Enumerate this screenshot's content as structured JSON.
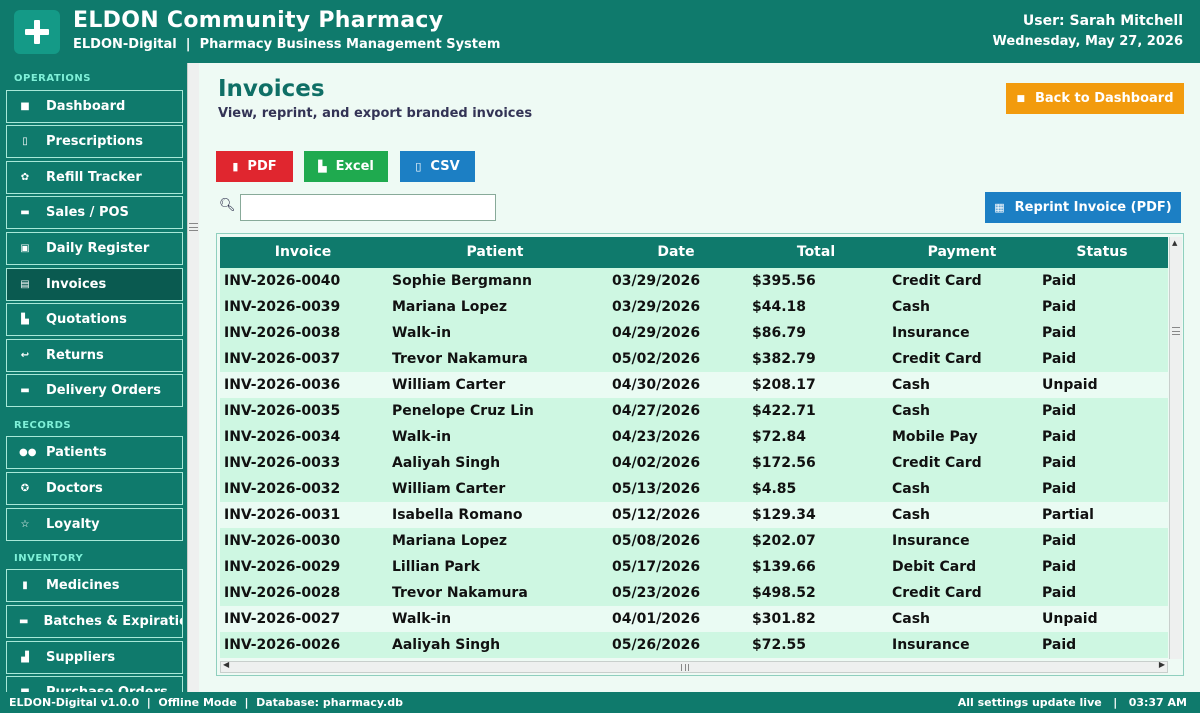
{
  "header": {
    "title": "ELDON Community Pharmacy",
    "subtitle": "ELDON-Digital  |  Pharmacy Business Management System",
    "user": "User: Sarah Mitchell",
    "date": "Wednesday, May 27, 2026"
  },
  "sidebar": {
    "sections": {
      "operations": "OPERATIONS",
      "records": "RECORDS",
      "inventory": "INVENTORY"
    },
    "items": [
      {
        "label": "Dashboard",
        "icon": "home-icon",
        "glyph": "■"
      },
      {
        "label": "Prescriptions",
        "icon": "clipboard-icon",
        "glyph": "▯"
      },
      {
        "label": "Refill Tracker",
        "icon": "refill-icon",
        "glyph": "✿"
      },
      {
        "label": "Sales / POS",
        "icon": "register-icon",
        "glyph": "▬"
      },
      {
        "label": "Daily Register",
        "icon": "calendar-icon",
        "glyph": "▣"
      },
      {
        "label": "Invoices",
        "icon": "invoice-icon",
        "glyph": "▤"
      },
      {
        "label": "Quotations",
        "icon": "document-icon",
        "glyph": "▙"
      },
      {
        "label": "Returns",
        "icon": "return-arrow-icon",
        "glyph": "↩"
      },
      {
        "label": "Delivery Orders",
        "icon": "truck-icon",
        "glyph": "▬"
      },
      {
        "label": "Patients",
        "icon": "users-icon",
        "glyph": "●●"
      },
      {
        "label": "Doctors",
        "icon": "stethoscope-icon",
        "glyph": "✪"
      },
      {
        "label": "Loyalty",
        "icon": "star-icon",
        "glyph": "☆"
      },
      {
        "label": "Medicines",
        "icon": "medicine-icon",
        "glyph": "▮"
      },
      {
        "label": "Batches & Expirations",
        "icon": "batch-icon",
        "glyph": "▬"
      },
      {
        "label": "Suppliers",
        "icon": "supplier-icon",
        "glyph": "▟"
      },
      {
        "label": "Purchase Orders",
        "icon": "purchase-icon",
        "glyph": "■"
      }
    ]
  },
  "page": {
    "title": "Invoices",
    "subtitle": "View, reprint, and export branded invoices",
    "back_label": "Back to Dashboard"
  },
  "export": {
    "pdf": "PDF",
    "excel": "Excel",
    "csv": "CSV"
  },
  "search": {
    "value": "",
    "placeholder": ""
  },
  "reprint_label": "Reprint Invoice (PDF)",
  "table": {
    "columns": [
      "Invoice",
      "Patient",
      "Date",
      "Total",
      "Payment",
      "Status"
    ],
    "rows": [
      [
        "INV-2026-0040",
        "Sophie Bergmann",
        "03/29/2026",
        "$395.56",
        "Credit Card",
        "Paid"
      ],
      [
        "INV-2026-0039",
        "Mariana Lopez",
        "03/29/2026",
        "$44.18",
        "Cash",
        "Paid"
      ],
      [
        "INV-2026-0038",
        "Walk-in",
        "04/29/2026",
        "$86.79",
        "Insurance",
        "Paid"
      ],
      [
        "INV-2026-0037",
        "Trevor Nakamura",
        "05/02/2026",
        "$382.79",
        "Credit Card",
        "Paid"
      ],
      [
        "INV-2026-0036",
        "William Carter",
        "04/30/2026",
        "$208.17",
        "Cash",
        "Unpaid"
      ],
      [
        "INV-2026-0035",
        "Penelope Cruz Lin",
        "04/27/2026",
        "$422.71",
        "Cash",
        "Paid"
      ],
      [
        "INV-2026-0034",
        "Walk-in",
        "04/23/2026",
        "$72.84",
        "Mobile Pay",
        "Paid"
      ],
      [
        "INV-2026-0033",
        "Aaliyah Singh",
        "04/02/2026",
        "$172.56",
        "Credit Card",
        "Paid"
      ],
      [
        "INV-2026-0032",
        "William Carter",
        "05/13/2026",
        "$4.85",
        "Cash",
        "Paid"
      ],
      [
        "INV-2026-0031",
        "Isabella Romano",
        "05/12/2026",
        "$129.34",
        "Cash",
        "Partial"
      ],
      [
        "INV-2026-0030",
        "Mariana Lopez",
        "05/08/2026",
        "$202.07",
        "Insurance",
        "Paid"
      ],
      [
        "INV-2026-0029",
        "Lillian Park",
        "05/17/2026",
        "$139.66",
        "Debit Card",
        "Paid"
      ],
      [
        "INV-2026-0028",
        "Trevor Nakamura",
        "05/23/2026",
        "$498.52",
        "Credit Card",
        "Paid"
      ],
      [
        "INV-2026-0027",
        "Walk-in",
        "04/01/2026",
        "$301.82",
        "Cash",
        "Unpaid"
      ],
      [
        "INV-2026-0026",
        "Aaliyah Singh",
        "05/26/2026",
        "$72.55",
        "Insurance",
        "Paid"
      ]
    ]
  },
  "footer": {
    "left": "ELDON-Digital v1.0.0  |  Offline Mode  |  Database: pharmacy.db",
    "right": "All settings update live   |   03:37 AM"
  },
  "colors": {
    "primary": "#0f7a6c",
    "pdf": "#e0262f",
    "excel": "#1faa4f",
    "csv": "#1c7fc4",
    "back": "#f29b0d",
    "row": "#cef7e2",
    "row_alt": "#eafbf3"
  }
}
